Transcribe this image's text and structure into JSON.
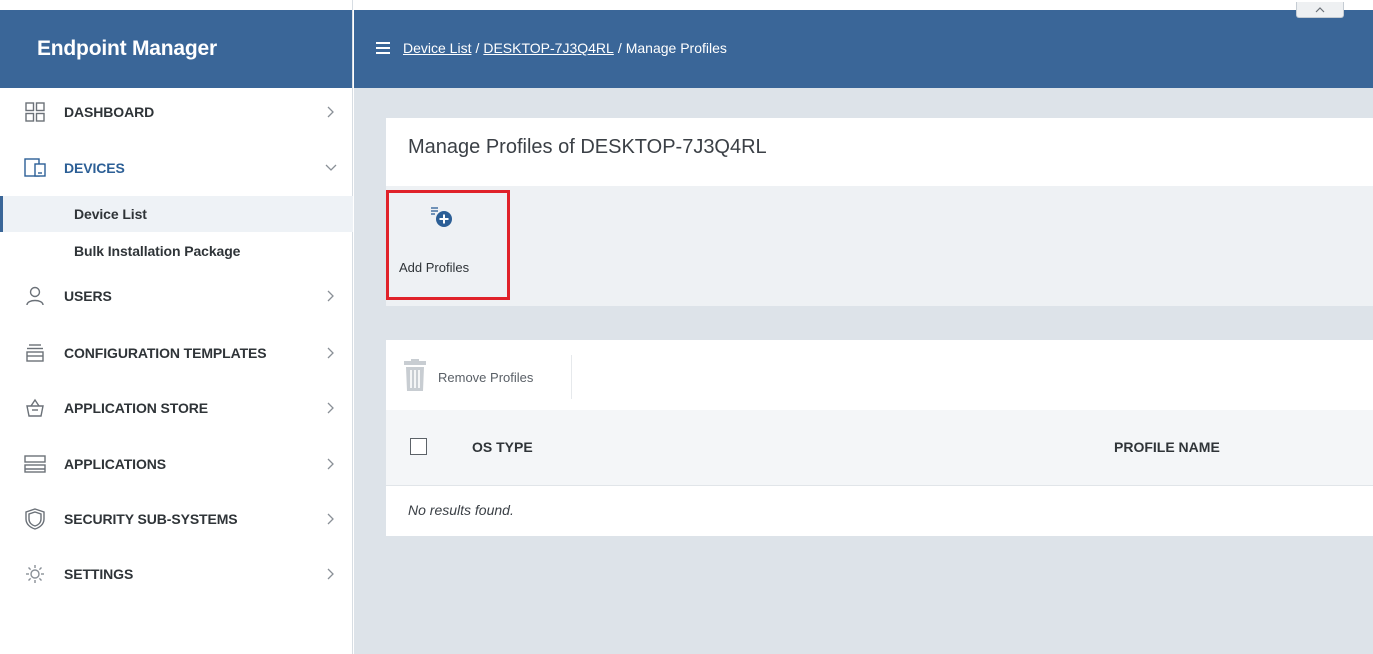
{
  "app": {
    "title": "Endpoint Manager"
  },
  "sidebar": {
    "items": [
      {
        "label": "DASHBOARD",
        "icon": "dashboard-grid-icon"
      },
      {
        "label": "DEVICES",
        "icon": "devices-icon",
        "expanded": true,
        "children": [
          {
            "label": "Device List",
            "active": true
          },
          {
            "label": "Bulk Installation Package"
          }
        ]
      },
      {
        "label": "USERS",
        "icon": "user-icon"
      },
      {
        "label": "CONFIGURATION TEMPLATES",
        "icon": "template-stack-icon"
      },
      {
        "label": "APPLICATION STORE",
        "icon": "store-basket-icon"
      },
      {
        "label": "APPLICATIONS",
        "icon": "applications-icon"
      },
      {
        "label": "SECURITY SUB-SYSTEMS",
        "icon": "shield-icon"
      },
      {
        "label": "SETTINGS",
        "icon": "gear-icon"
      }
    ]
  },
  "header": {
    "breadcrumb": {
      "crumb1": "Device List",
      "sep": "/",
      "crumb2": "DESKTOP-7J3Q4RL",
      "current": "Manage Profiles"
    }
  },
  "main": {
    "title": "Manage Profiles of DESKTOP-7J3Q4RL",
    "add_profiles_label": "Add Profiles",
    "remove_profiles_label": "Remove Profiles",
    "table": {
      "columns": [
        "OS TYPE",
        "PROFILE NAME"
      ],
      "empty_text": "No results found."
    }
  },
  "colors": {
    "header_bg": "#3a6698",
    "highlight_border": "#e0222a",
    "content_bg": "#dde3e9",
    "icon_blue": "#2c5f96"
  }
}
